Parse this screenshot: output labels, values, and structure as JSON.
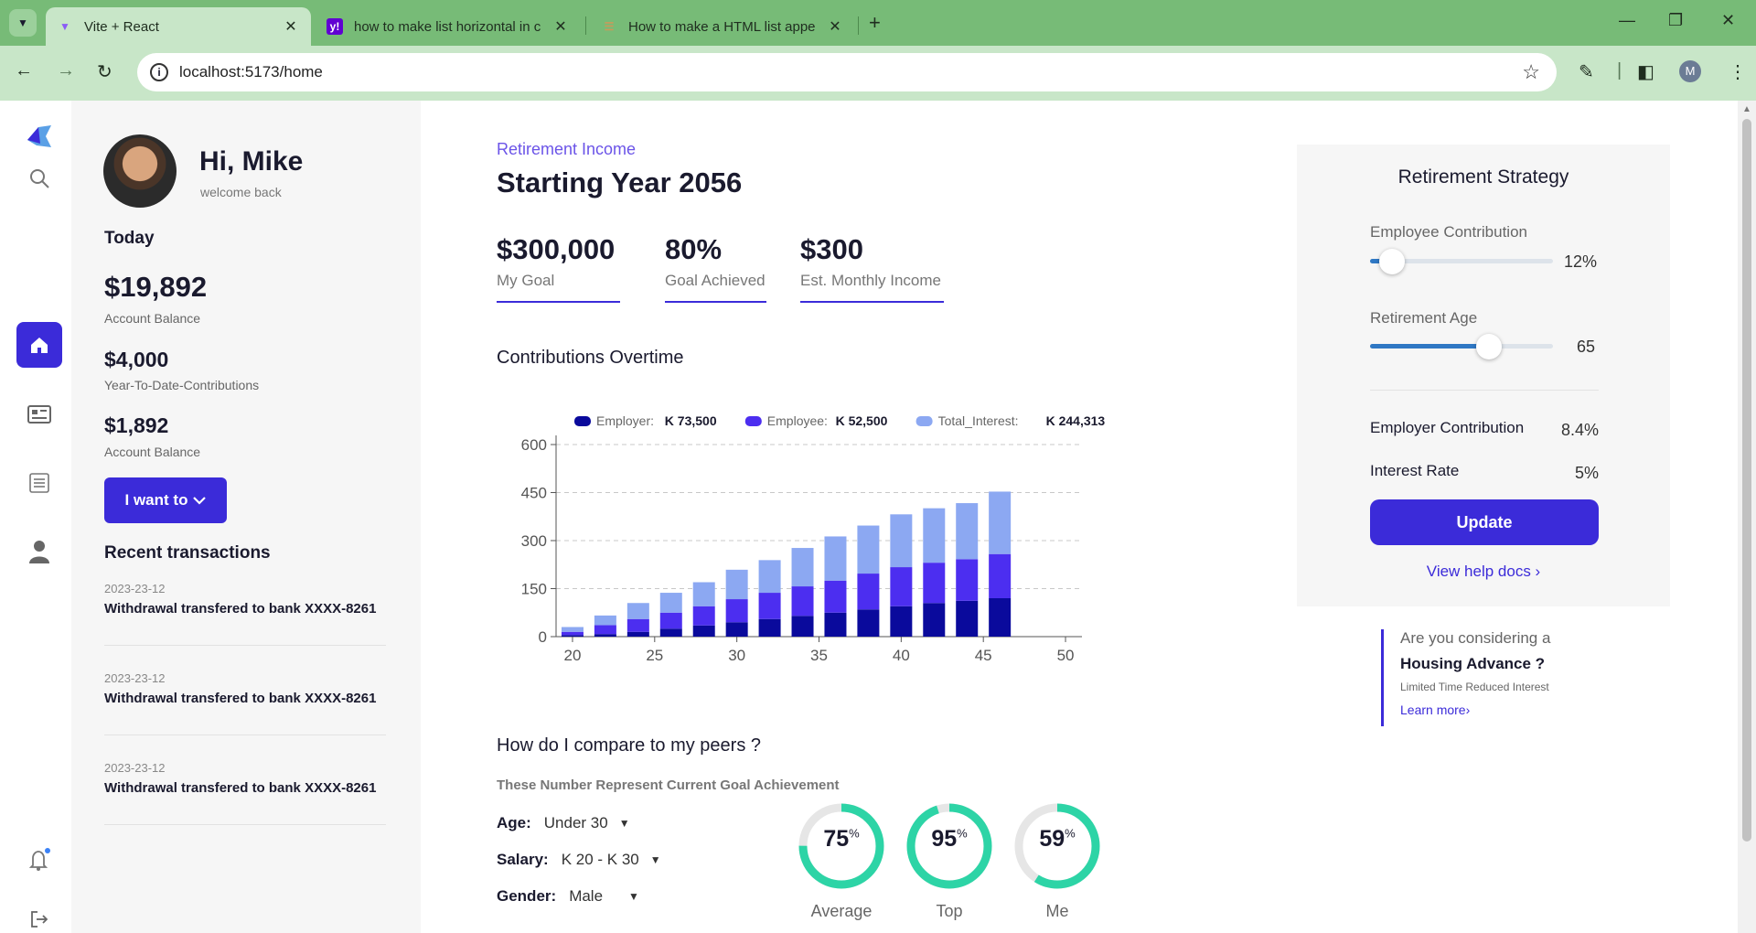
{
  "browser": {
    "tabs": [
      {
        "title": "Vite + React",
        "favicon": "vite-icon",
        "active": true
      },
      {
        "title": "how to make list horizontal in c",
        "favicon": "yahoo-icon",
        "active": false
      },
      {
        "title": "How to make a HTML list appe",
        "favicon": "stack-icon",
        "active": false
      }
    ],
    "url": "localhost:5173/home",
    "profile_initial": "M"
  },
  "profile": {
    "greeting": "Hi, Mike",
    "welcome": "welcome back",
    "today_label": "Today",
    "balances": [
      {
        "value": "$19,892",
        "label": "Account Balance"
      },
      {
        "value": "$4,000",
        "label": "Year-To-Date-Contributions"
      },
      {
        "value": "$1,892",
        "label": "Account Balance"
      }
    ],
    "action_label": "I want to",
    "recent_title": "Recent transactions",
    "transactions": [
      {
        "date": "2023-23-12",
        "desc": "Withdrawal transfered to bank XXXX-8261"
      },
      {
        "date": "2023-23-12",
        "desc": "Withdrawal transfered to bank XXXX-8261"
      },
      {
        "date": "2023-23-12",
        "desc": "Withdrawal transfered to bank XXXX-8261"
      }
    ]
  },
  "main": {
    "kicker": "Retirement Income",
    "heading": "Starting Year 2056",
    "kpis": [
      {
        "value": "$300,000",
        "label": "My Goal"
      },
      {
        "value": "80%",
        "label": "Goal Achieved"
      },
      {
        "value": "$300",
        "label": "Est. Monthly Income"
      }
    ],
    "contributions_title": "Contributions Overtime",
    "peers_title": "How do I compare to my peers ?",
    "peers_subtitle": "These Number Represent Current Goal Achievement",
    "filters": [
      {
        "key": "Age:",
        "value": "Under 30"
      },
      {
        "key": "Salary:",
        "value": "K 20 - K 30"
      },
      {
        "key": "Gender:",
        "value": "Male"
      }
    ],
    "rings": [
      {
        "value": 75,
        "label": "Average"
      },
      {
        "value": 95,
        "label": "Top"
      },
      {
        "value": 59,
        "label": "Me"
      }
    ]
  },
  "chart_data": {
    "type": "bar",
    "stacked": true,
    "x": [
      20,
      22,
      24,
      26,
      28,
      30,
      32,
      34,
      36,
      38,
      40,
      42,
      44,
      46
    ],
    "xticks": [
      20,
      25,
      30,
      35,
      40,
      45,
      50
    ],
    "ylim": [
      0,
      600
    ],
    "yticks": [
      0,
      150,
      300,
      450,
      600
    ],
    "grid": true,
    "legend_position": "top",
    "series": [
      {
        "name": "Employer:",
        "total": "K 73,500",
        "color": "#0a0a9c",
        "values": [
          5,
          8,
          15,
          25,
          35,
          45,
          55,
          65,
          75,
          85,
          95,
          105,
          112,
          120
        ]
      },
      {
        "name": "Employee:",
        "total": "K 52,500",
        "color": "#4c2ef0",
        "values": [
          10,
          28,
          40,
          50,
          60,
          72,
          82,
          92,
          100,
          112,
          122,
          126,
          130,
          138
        ]
      },
      {
        "name": "Total_Interest:",
        "total": "K 244,313",
        "color": "#8ca8f2",
        "values": [
          15,
          30,
          50,
          62,
          75,
          92,
          102,
          120,
          138,
          150,
          165,
          170,
          175,
          195
        ]
      }
    ],
    "xticks_labels": [
      "20",
      "25",
      "30",
      "35",
      "40",
      "45",
      "50"
    ]
  },
  "strategy": {
    "title": "Retirement Strategy",
    "employee_label": "Employee Contribution",
    "employee_value": "12%",
    "employee_fraction": 0.12,
    "age_label": "Retirement Age",
    "age_value": "65",
    "age_fraction": 0.65,
    "rows": [
      {
        "key": "Employer Contribution",
        "value": "8.4%"
      },
      {
        "key": "Interest Rate",
        "value": "5%"
      }
    ],
    "update_label": "Update",
    "help_label": "View help docs ›"
  },
  "housing": {
    "question": "Are you considering a",
    "headline": "Housing Advance ?",
    "subline": "Limited Time Reduced Interest",
    "link": "Learn more›"
  },
  "colors": {
    "accent": "#3b2bd9",
    "ring": "#2dd4a6",
    "ring_bg": "#e6e6e6"
  }
}
